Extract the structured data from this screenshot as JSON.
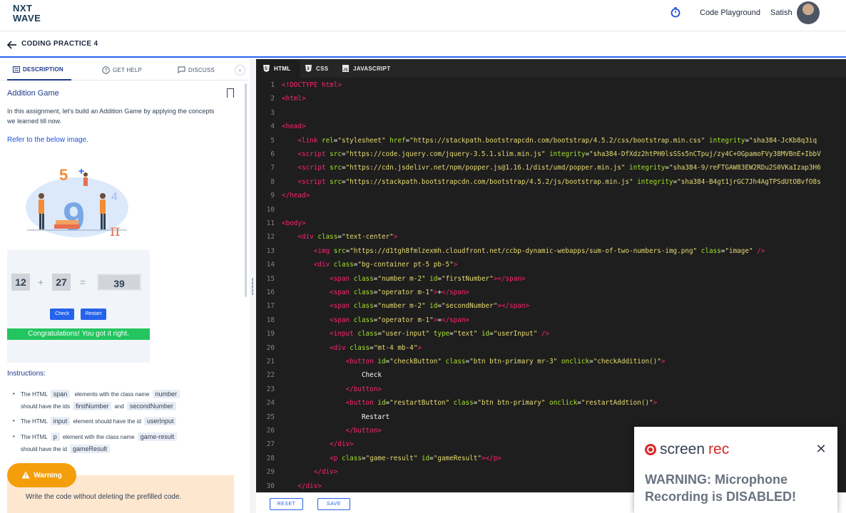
{
  "header": {
    "logo_line1": "NXT",
    "logo_line2": "WAVE",
    "code_playground": "Code Playground",
    "user_name": "Satish"
  },
  "subheader": {
    "title": "CODING PRACTICE 4"
  },
  "left_tabs": [
    {
      "label": "DESCRIPTION",
      "icon": "document-icon",
      "active": true
    },
    {
      "label": "GET HELP",
      "icon": "help-circle-icon",
      "active": false
    },
    {
      "label": "DISCUSS",
      "icon": "chat-icon",
      "active": false
    }
  ],
  "description": {
    "title": "Addition Game",
    "text": "In this assignment, let's build an Addition Game by applying the concepts we learned till now.",
    "refer": "Refer to the below image."
  },
  "preview": {
    "first": "12",
    "plus": "+",
    "second": "27",
    "equals": "=",
    "answer": "39",
    "check": "Check",
    "restart": "Restart",
    "result": "Congratulations! You got it right."
  },
  "instructions": {
    "title": "Instructions:",
    "items": [
      {
        "pre": "The HTML",
        "c1": "span",
        "mid": "elements with the class name",
        "c2": "number",
        "line2_pre": "should have the ids",
        "c3": "firstNumber",
        "and": "and",
        "c4": "secondNumber"
      },
      {
        "pre": "The HTML",
        "c1": "input",
        "mid": "element should have the id",
        "c2": "userInput"
      },
      {
        "pre": "The HTML",
        "c1": "p",
        "mid": "element with the class name",
        "c2": "game-result",
        "line2_pre": "should have the id",
        "c3": "gameResult"
      }
    ]
  },
  "warning": {
    "label": "Warning",
    "text": "Write the code without deleting the prefilled code."
  },
  "editor_tabs": [
    {
      "label": "HTML",
      "icon": "html5-icon",
      "active": true
    },
    {
      "label": "CSS",
      "icon": "css3-icon",
      "active": false
    },
    {
      "label": "JAVASCRIPT",
      "icon": "js-icon",
      "active": false
    }
  ],
  "code_lines": [
    {
      "n": "1",
      "parts": [
        [
          "tag",
          "<!DOCTYPE html>"
        ]
      ]
    },
    {
      "n": "2",
      "parts": [
        [
          "tag",
          "<html>"
        ]
      ]
    },
    {
      "n": "3",
      "parts": []
    },
    {
      "n": "4",
      "parts": [
        [
          "tag",
          "<head>"
        ]
      ]
    },
    {
      "n": "5",
      "parts": [
        [
          "txt",
          "    "
        ],
        [
          "tag",
          "<link "
        ],
        [
          "attr",
          "rel"
        ],
        [
          "txt",
          "="
        ],
        [
          "str",
          "\"stylesheet\""
        ],
        [
          "txt",
          " "
        ],
        [
          "attr",
          "href"
        ],
        [
          "txt",
          "="
        ],
        [
          "str",
          "\"https://stackpath.bootstrapcdn.com/bootstrap/4.5.2/css/bootstrap.min.css\""
        ],
        [
          "txt",
          " "
        ],
        [
          "attr",
          "integrity"
        ],
        [
          "txt",
          "="
        ],
        [
          "str",
          "\"sha384-JcKb8q3iq"
        ]
      ]
    },
    {
      "n": "6",
      "parts": [
        [
          "txt",
          "    "
        ],
        [
          "tag",
          "<script "
        ],
        [
          "attr",
          "src"
        ],
        [
          "txt",
          "="
        ],
        [
          "str",
          "\"https://code.jquery.com/jquery-3.5.1.slim.min.js\""
        ],
        [
          "txt",
          " "
        ],
        [
          "attr",
          "integrity"
        ],
        [
          "txt",
          "="
        ],
        [
          "str",
          "\"sha384-DfXdz2htPH0lsSSs5nCTpuj/zy4C+OGpamoFVy38MVBnE+IbbV"
        ]
      ]
    },
    {
      "n": "7",
      "parts": [
        [
          "txt",
          "    "
        ],
        [
          "tag",
          "<script "
        ],
        [
          "attr",
          "src"
        ],
        [
          "txt",
          "="
        ],
        [
          "str",
          "\"https://cdn.jsdelivr.net/npm/popper.js@1.16.1/dist/umd/popper.min.js\""
        ],
        [
          "txt",
          " "
        ],
        [
          "attr",
          "integrity"
        ],
        [
          "txt",
          "="
        ],
        [
          "str",
          "\"sha384-9/reFTGAW83EW2RDu2S0VKaIzap3H6"
        ]
      ]
    },
    {
      "n": "8",
      "parts": [
        [
          "txt",
          "    "
        ],
        [
          "tag",
          "<script "
        ],
        [
          "attr",
          "src"
        ],
        [
          "txt",
          "="
        ],
        [
          "str",
          "\"https://stackpath.bootstrapcdn.com/bootstrap/4.5.2/js/bootstrap.min.js\""
        ],
        [
          "txt",
          " "
        ],
        [
          "attr",
          "integrity"
        ],
        [
          "txt",
          "="
        ],
        [
          "str",
          "\"sha384-B4gt1jrGC7Jh4AgTPSdUtOBvfO8s"
        ]
      ]
    },
    {
      "n": "9",
      "parts": [
        [
          "tag",
          "</head>"
        ]
      ]
    },
    {
      "n": "10",
      "parts": []
    },
    {
      "n": "11",
      "parts": [
        [
          "tag",
          "<body>"
        ]
      ]
    },
    {
      "n": "12",
      "parts": [
        [
          "txt",
          "    "
        ],
        [
          "tag",
          "<div "
        ],
        [
          "attr",
          "class"
        ],
        [
          "txt",
          "="
        ],
        [
          "str",
          "\"text-center\""
        ],
        [
          "tag",
          ">"
        ]
      ]
    },
    {
      "n": "13",
      "parts": [
        [
          "txt",
          "        "
        ],
        [
          "tag",
          "<img "
        ],
        [
          "attr",
          "src"
        ],
        [
          "txt",
          "="
        ],
        [
          "str",
          "\"https://d1tgh8fmlzexmh.cloudfront.net/ccbp-dynamic-webapps/sum-of-two-numbers-img.png\""
        ],
        [
          "txt",
          " "
        ],
        [
          "attr",
          "class"
        ],
        [
          "txt",
          "="
        ],
        [
          "str",
          "\"image\""
        ],
        [
          "txt",
          " "
        ],
        [
          "tag",
          "/>"
        ]
      ]
    },
    {
      "n": "14",
      "parts": [
        [
          "txt",
          "        "
        ],
        [
          "tag",
          "<div "
        ],
        [
          "attr",
          "class"
        ],
        [
          "txt",
          "="
        ],
        [
          "str",
          "\"bg-container pt-5 pb-5\""
        ],
        [
          "tag",
          ">"
        ]
      ]
    },
    {
      "n": "15",
      "parts": [
        [
          "txt",
          "            "
        ],
        [
          "tag",
          "<span "
        ],
        [
          "attr",
          "class"
        ],
        [
          "txt",
          "="
        ],
        [
          "str",
          "\"number m-2\""
        ],
        [
          "txt",
          " "
        ],
        [
          "attr",
          "id"
        ],
        [
          "txt",
          "="
        ],
        [
          "str",
          "\"firstNumber\""
        ],
        [
          "tag",
          "></span>"
        ]
      ]
    },
    {
      "n": "16",
      "parts": [
        [
          "txt",
          "            "
        ],
        [
          "tag",
          "<span "
        ],
        [
          "attr",
          "class"
        ],
        [
          "txt",
          "="
        ],
        [
          "str",
          "\"operator m-1\""
        ],
        [
          "tag",
          ">"
        ],
        [
          "txt",
          "+"
        ],
        [
          "tag",
          "</span>"
        ]
      ]
    },
    {
      "n": "17",
      "parts": [
        [
          "txt",
          "            "
        ],
        [
          "tag",
          "<span "
        ],
        [
          "attr",
          "class"
        ],
        [
          "txt",
          "="
        ],
        [
          "str",
          "\"number m-2\""
        ],
        [
          "txt",
          " "
        ],
        [
          "attr",
          "id"
        ],
        [
          "txt",
          "="
        ],
        [
          "str",
          "\"secondNumber\""
        ],
        [
          "tag",
          "></span>"
        ]
      ]
    },
    {
      "n": "18",
      "parts": [
        [
          "txt",
          "            "
        ],
        [
          "tag",
          "<span "
        ],
        [
          "attr",
          "class"
        ],
        [
          "txt",
          "="
        ],
        [
          "str",
          "\"operator m-1\""
        ],
        [
          "tag",
          ">"
        ],
        [
          "txt",
          "="
        ],
        [
          "tag",
          "</span>"
        ]
      ]
    },
    {
      "n": "19",
      "parts": [
        [
          "txt",
          "            "
        ],
        [
          "tag",
          "<input "
        ],
        [
          "attr",
          "class"
        ],
        [
          "txt",
          "="
        ],
        [
          "str",
          "\"user-input\""
        ],
        [
          "txt",
          " "
        ],
        [
          "attr",
          "type"
        ],
        [
          "txt",
          "="
        ],
        [
          "str",
          "\"text\""
        ],
        [
          "txt",
          " "
        ],
        [
          "attr",
          "id"
        ],
        [
          "txt",
          "="
        ],
        [
          "str",
          "\"userInput\""
        ],
        [
          "txt",
          " "
        ],
        [
          "tag",
          "/>"
        ]
      ]
    },
    {
      "n": "20",
      "parts": [
        [
          "txt",
          "            "
        ],
        [
          "tag",
          "<div "
        ],
        [
          "attr",
          "class"
        ],
        [
          "txt",
          "="
        ],
        [
          "str",
          "\"mt-4 mb-4\""
        ],
        [
          "tag",
          ">"
        ]
      ]
    },
    {
      "n": "21",
      "parts": [
        [
          "txt",
          "                "
        ],
        [
          "tag",
          "<button "
        ],
        [
          "attr",
          "id"
        ],
        [
          "txt",
          "="
        ],
        [
          "str",
          "\"checkButton\""
        ],
        [
          "txt",
          " "
        ],
        [
          "attr",
          "class"
        ],
        [
          "txt",
          "="
        ],
        [
          "str",
          "\"btn btn-primary mr-3\""
        ],
        [
          "txt",
          " "
        ],
        [
          "attr",
          "onclick"
        ],
        [
          "txt",
          "="
        ],
        [
          "str",
          "\"checkAddition()\""
        ],
        [
          "tag",
          ">"
        ]
      ]
    },
    {
      "n": "22",
      "parts": [
        [
          "txt",
          "                    Check"
        ]
      ]
    },
    {
      "n": "23",
      "parts": [
        [
          "txt",
          "                "
        ],
        [
          "tag",
          "</button>"
        ]
      ]
    },
    {
      "n": "24",
      "parts": [
        [
          "txt",
          "                "
        ],
        [
          "tag",
          "<button "
        ],
        [
          "attr",
          "id"
        ],
        [
          "txt",
          "="
        ],
        [
          "str",
          "\"restartButton\""
        ],
        [
          "txt",
          " "
        ],
        [
          "attr",
          "class"
        ],
        [
          "txt",
          "="
        ],
        [
          "str",
          "\"btn btn-primary\""
        ],
        [
          "txt",
          " "
        ],
        [
          "attr",
          "onclick"
        ],
        [
          "txt",
          "="
        ],
        [
          "str",
          "\"restartAddtion()\""
        ],
        [
          "tag",
          ">"
        ]
      ]
    },
    {
      "n": "25",
      "parts": [
        [
          "txt",
          "                    Restart"
        ]
      ]
    },
    {
      "n": "26",
      "parts": [
        [
          "txt",
          "                "
        ],
        [
          "tag",
          "</button>"
        ]
      ]
    },
    {
      "n": "27",
      "parts": [
        [
          "txt",
          "            "
        ],
        [
          "tag",
          "</div>"
        ]
      ]
    },
    {
      "n": "28",
      "parts": [
        [
          "txt",
          "            "
        ],
        [
          "tag",
          "<p "
        ],
        [
          "attr",
          "class"
        ],
        [
          "txt",
          "="
        ],
        [
          "str",
          "\"game-result\""
        ],
        [
          "txt",
          " "
        ],
        [
          "attr",
          "id"
        ],
        [
          "txt",
          "="
        ],
        [
          "str",
          "\"gameResult\""
        ],
        [
          "tag",
          "></p>"
        ]
      ]
    },
    {
      "n": "29",
      "parts": [
        [
          "txt",
          "        "
        ],
        [
          "tag",
          "</div>"
        ]
      ]
    },
    {
      "n": "30",
      "parts": [
        [
          "txt",
          "    "
        ],
        [
          "tag",
          "</div>"
        ]
      ]
    }
  ],
  "bottom": {
    "reset": "RESET",
    "save": "SAVE"
  },
  "screenrec": {
    "brand_a": "screen",
    "brand_b": "rec",
    "warning": "WARNING: Microphone Recording is DISABLED!"
  }
}
